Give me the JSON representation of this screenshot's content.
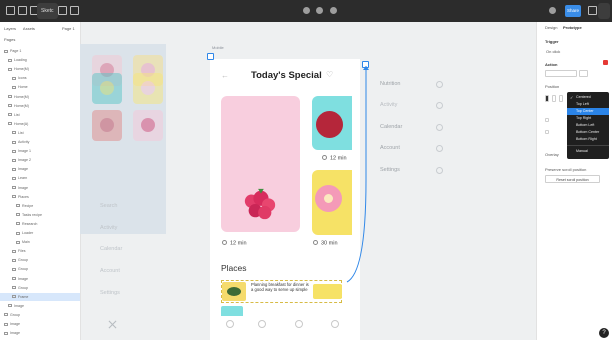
{
  "toolbar": {
    "file_tab": "Sketc",
    "share_label": "Share"
  },
  "left_panel": {
    "tabs": [
      "Layers",
      "Assets"
    ],
    "page_tab": "Page 1",
    "pages_title": "Pages",
    "layers": [
      "Page 1",
      "Loading",
      "Home(M)",
      "Icons",
      "Home",
      "Home(M)",
      "Home(M)",
      "List",
      "Home(A)",
      "List",
      "Activity",
      "Image 1",
      "Image 2",
      "Image",
      "Learn",
      "Image",
      "Places",
      "Recipe",
      "Tasks recipe",
      "Research",
      "Loader",
      "Main",
      "Files",
      "Group",
      "Group",
      "Image",
      "Group",
      "Frame",
      "Image",
      "Group",
      "Image",
      "Image"
    ]
  },
  "faded_frame": {
    "nav": [
      "Search",
      "Activity",
      "Calendar",
      "Account",
      "Settings"
    ]
  },
  "main_frame": {
    "frame_label": "Mobile",
    "title": "Today's Special",
    "time1": "12 min",
    "time2": "30 min",
    "time3": "12 min",
    "places_title": "Places",
    "place_text": "Planning breakfast for dinner is a good way to serve up simple"
  },
  "side_nav": [
    "Nutrition",
    "Activity",
    "Calendar",
    "Account",
    "Settings"
  ],
  "right_panel": {
    "tabs": [
      "Design",
      "Prototype"
    ],
    "trigger_label": "Trigger",
    "trigger_value": "On click",
    "action_label": "Action",
    "position_label": "Position",
    "state_label": "Overlay",
    "scroll_label": "Preserve scroll position",
    "reset_button": "Reset scroll position"
  },
  "dropdown": {
    "items": [
      "Centered",
      "Top Left",
      "Top Center",
      "Top Right",
      "Bottom Left",
      "Bottom Center",
      "Bottom Right",
      "Manual"
    ],
    "checked_index": 0,
    "highlighted_index": 2
  },
  "colors": {
    "selection": "#2f87e8",
    "highlight": "#2b84e7",
    "card_pink": "#f8cede",
    "card_teal": "#7fdfe0",
    "card_yellow": "#f6e266"
  }
}
